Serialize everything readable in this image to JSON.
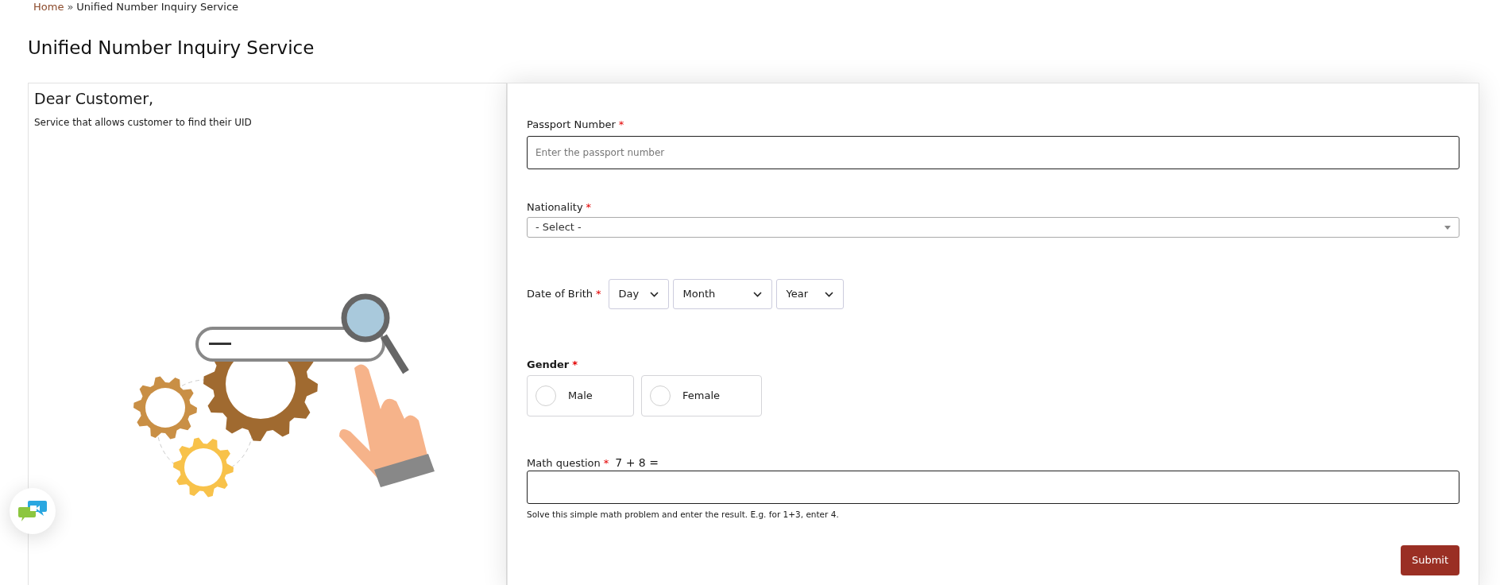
{
  "breadcrumb": [
    {
      "label": "Home",
      "kind": "link"
    },
    {
      "label": "»",
      "kind": "separator"
    },
    {
      "label": "Unified Number Inquiry Service",
      "kind": "current"
    }
  ],
  "title": "Unified Number Inquiry Service",
  "intro": {
    "heading": "Dear Customer,",
    "text": "Service that allows customer to find their UID"
  },
  "form": {
    "fields": [
      {
        "kind": "text",
        "label": "Passport Number",
        "required_mark": "*",
        "placeholder": "Enter the passport number"
      },
      {
        "kind": "select",
        "label": "Nationality",
        "required_mark": "*",
        "value": "- Select -"
      },
      {
        "kind": "date",
        "label": "Date of Brith",
        "required_mark": "*",
        "parts": [
          "Day",
          "Month",
          "Year"
        ]
      },
      {
        "kind": "radio",
        "label": "Gender",
        "required_mark": "*",
        "options": [
          {
            "label": "Male",
            "selected": false
          },
          {
            "label": "Female",
            "selected": false
          }
        ]
      },
      {
        "kind": "captcha",
        "label": "Math question",
        "required_mark": "*",
        "question": "7 + 8 =",
        "hint": "Solve this simple math problem and enter the result. E.g. for 1+3, enter 4."
      }
    ],
    "submit": "Submit"
  }
}
